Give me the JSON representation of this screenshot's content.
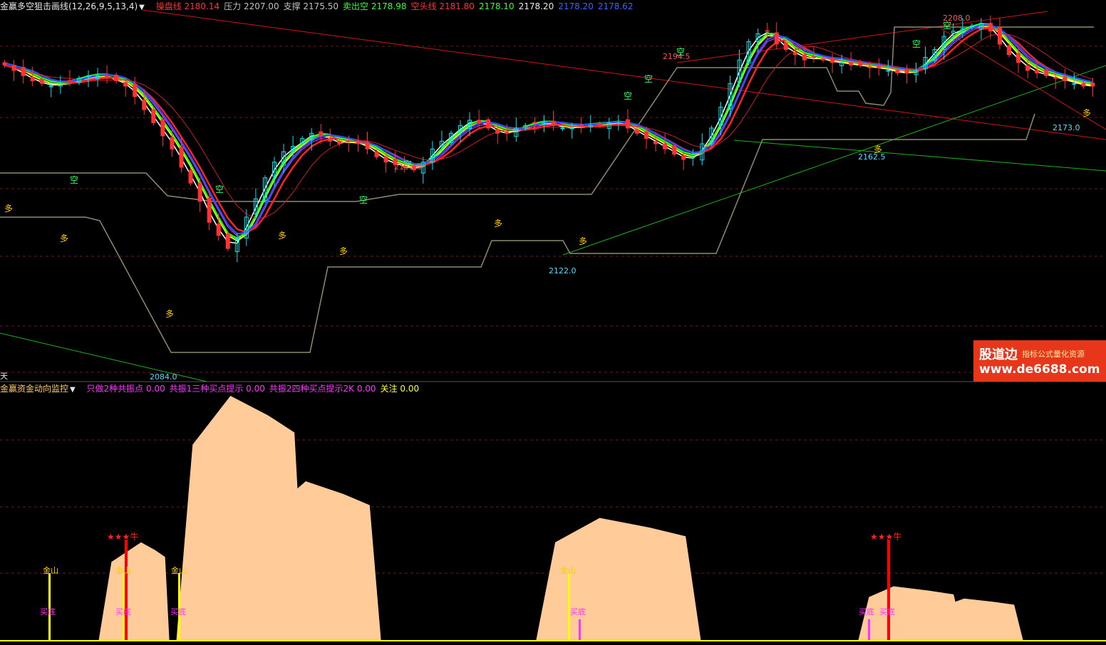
{
  "upper_panel": {
    "title": "金赢多空狙击画线(12,26,9,5,13,4)",
    "indicators": [
      {
        "label": "操盘线",
        "value": "2180.14",
        "color": "#ff3333"
      },
      {
        "label": "压力",
        "value": "2207.00",
        "color": "#c0c0c0"
      },
      {
        "label": "支撑",
        "value": "2175.50",
        "color": "#c0c0c0"
      },
      {
        "label": "卖出空",
        "value": "2178.98",
        "color": "#33ff33"
      },
      {
        "label": "空头线",
        "value": "2181.80",
        "color": "#ff3333"
      },
      {
        "label": "",
        "value": "2178.10",
        "color": "#33ff33"
      },
      {
        "label": "",
        "value": "2178.20",
        "color": "#e8e8e8"
      },
      {
        "label": "",
        "value": "2178.20",
        "color": "#3366ff"
      },
      {
        "label": "",
        "value": "2178.62",
        "color": "#3366ff"
      }
    ],
    "period_label": "天"
  },
  "lower_panel": {
    "title": "金赢资金动向监控",
    "indicators": [
      {
        "label": "只做2种共振点",
        "value": "0.00",
        "color": "#ff33ff"
      },
      {
        "label": "共振1三种买点提示",
        "value": "0.00",
        "color": "#ff33ff"
      },
      {
        "label": "共振2四种买点提示2K",
        "value": "0.00",
        "color": "#ff33ff"
      },
      {
        "label": "关注",
        "value": "0.00",
        "color": "#ffff33"
      }
    ]
  },
  "watermark": {
    "brand": "股道边",
    "tagline": "指标公式量化资源",
    "url": "www.de6688.com"
  },
  "colors": {
    "up_candle": "#00e5ee",
    "down_candle": "#ff3333",
    "bg": "#000000",
    "area": "#ffcc99",
    "buy": "#ff33ff",
    "gold": "#ffff00",
    "signal": "#ff0000",
    "support_line": "#8c8c6c"
  },
  "chart_data": [
    {
      "type": "candlestick",
      "title": "金赢多空狙击画线(12,26,9,5,13,4)",
      "ylim": [
        2075,
        2212
      ],
      "close_series": [
        2192,
        2190,
        2188,
        2186,
        2185,
        2184,
        2185,
        2186,
        2187,
        2188,
        2188,
        2187,
        2186,
        2184,
        2180,
        2175,
        2170,
        2165,
        2160,
        2153,
        2147,
        2140,
        2132,
        2127,
        2122,
        2126,
        2134,
        2141,
        2149,
        2155,
        2159,
        2161,
        2164,
        2166,
        2165,
        2163,
        2162,
        2163,
        2162,
        2160,
        2157,
        2155,
        2154,
        2153,
        2152,
        2155,
        2160,
        2163,
        2166,
        2169,
        2171,
        2170,
        2168,
        2166,
        2166,
        2168,
        2169,
        2170,
        2170,
        2169,
        2168,
        2168,
        2169,
        2169,
        2169,
        2170,
        2170,
        2168,
        2166,
        2164,
        2162,
        2160,
        2158,
        2156,
        2157,
        2162,
        2168,
        2176,
        2185,
        2194,
        2201,
        2204,
        2205,
        2200,
        2198,
        2196,
        2194,
        2195,
        2194,
        2193,
        2193,
        2192,
        2192,
        2191,
        2191,
        2190,
        2189,
        2189,
        2190,
        2195,
        2198,
        2203,
        2205,
        2206,
        2207,
        2208,
        2205,
        2200,
        2196,
        2193,
        2190,
        2189,
        2188,
        2187,
        2186,
        2185,
        2184,
        2184
      ],
      "annotations": {
        "price_labels": [
          {
            "text": "2084.0",
            "kind": "low"
          },
          {
            "text": "2135.0",
            "kind": "high"
          },
          {
            "text": "2122.0",
            "kind": "low"
          },
          {
            "text": "2194.5",
            "kind": "high"
          },
          {
            "text": "2162.5",
            "kind": "low"
          },
          {
            "text": "2208.0",
            "kind": "high"
          },
          {
            "text": "2173.0",
            "kind": "low"
          }
        ],
        "bull_marker": "多",
        "bear_marker": "空"
      }
    },
    {
      "type": "area",
      "title": "金赢资金动向监控",
      "ylim": [
        0,
        100
      ],
      "humps": [
        {
          "start": 0.42,
          "peak": 0.6,
          "end": 0.72
        },
        {
          "start": 0.75,
          "peak": 0.98,
          "end": 1.3
        },
        {
          "start": 0.95,
          "peak": 1.12,
          "end": 1.5
        },
        {
          "start": 1.08,
          "peak": 1.3,
          "end": 1.62
        },
        {
          "start": 2.28,
          "peak": 2.55,
          "end": 2.98
        },
        {
          "start": 3.65,
          "peak": 3.8,
          "end": 4.1
        },
        {
          "start": 3.96,
          "peak": 4.1,
          "end": 4.35
        }
      ],
      "hump_heights": [
        40,
        100,
        30,
        65,
        50,
        22,
        17
      ],
      "signals": {
        "gold_mountain_label": "金山",
        "buy_bottom_label": "买底",
        "star_label": "★★★牛"
      }
    }
  ]
}
